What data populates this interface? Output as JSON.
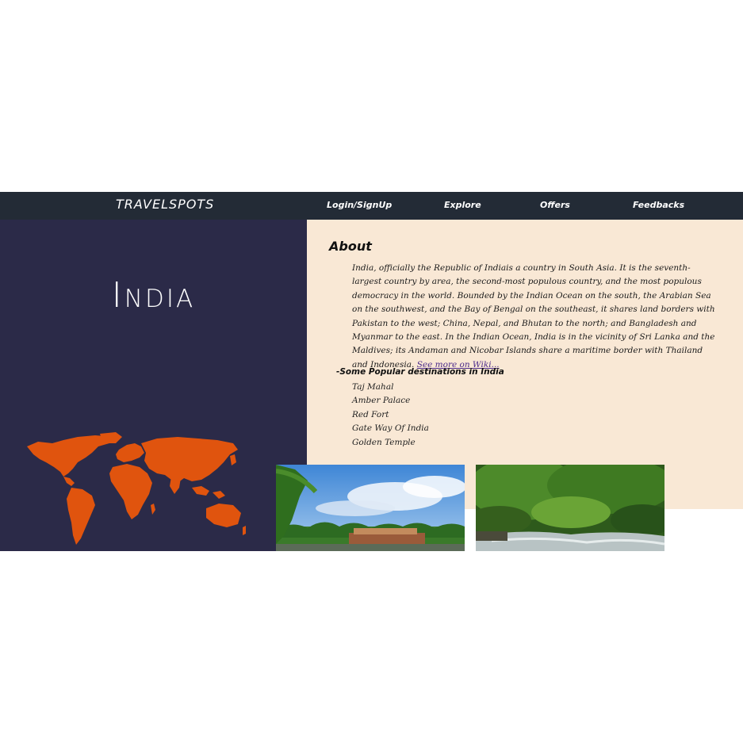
{
  "navbar": {
    "brand": "TRAVELSPOTS",
    "links": [
      "Login/SignUp",
      "Explore",
      "Offers",
      "Feedbacks"
    ]
  },
  "hero": {
    "country": "India"
  },
  "about": {
    "heading": "About",
    "text": "India, officially the Republic of Indiais a country in South Asia. It is the seventh-largest country by area, the second-most populous country, and the most populous democracy in the world. Bounded by the Indian Ocean on the south, the Arabian Sea on the southwest, and the Bay of Bengal on the southeast, it shares land borders with Pakistan to the west; China, Nepal, and Bhutan to the north; and Bangladesh and Myanmar to the east. In the Indian Ocean, India is in the vicinity of Sri Lanka and the Maldives; its Andaman and Nicobar Islands share a maritime border with Thailand and Indonesia.",
    "wiki_link": "See more on Wiki...",
    "destinations_heading": "-Some Popular destinations in India",
    "destinations": [
      "Taj Mahal",
      "Amber Palace",
      "Red Fort",
      "Gate Way Of India",
      "Golden Temple"
    ]
  },
  "colors": {
    "navbar": "#232b36",
    "left_panel": "#2b2a48",
    "about_panel": "#f9e8d5",
    "map": "#e0540e",
    "link": "#4b2a8a"
  }
}
